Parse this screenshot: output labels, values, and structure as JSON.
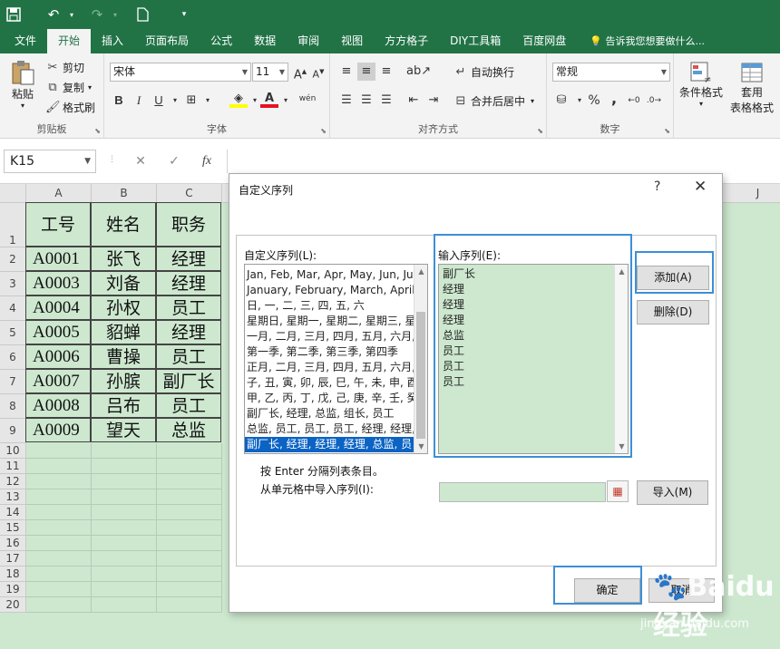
{
  "quick_access": {
    "save": "save-icon",
    "undo": "undo-icon",
    "redo": "redo-icon",
    "new": "new-file-icon",
    "customize": "customize-icon"
  },
  "tabs": [
    "文件",
    "开始",
    "插入",
    "页面布局",
    "公式",
    "数据",
    "审阅",
    "视图",
    "方方格子",
    "DIY工具箱",
    "百度网盘"
  ],
  "active_tab": "开始",
  "tell_me": "告诉我您想要做什么...",
  "ribbon": {
    "clipboard": {
      "paste": "粘贴",
      "cut": "剪切",
      "copy": "复制",
      "format_painter": "格式刷",
      "label": "剪贴板"
    },
    "font": {
      "name": "宋体",
      "size": "11",
      "bold": "B",
      "italic": "I",
      "underline": "U",
      "label": "字体",
      "phonetic": "wén"
    },
    "alignment": {
      "wrap": "自动换行",
      "merge": "合并后居中",
      "label": "对齐方式"
    },
    "number": {
      "format": "常规",
      "percent": "%",
      "comma": ",",
      "label": "数字"
    },
    "styles": {
      "conditional": "条件格式",
      "table_fmt_1": "套用",
      "table_fmt_2": "表格格式"
    }
  },
  "formula_bar": {
    "name_box": "K15",
    "cancel": "✕",
    "enter": "✓",
    "fx": "fx"
  },
  "sheet": {
    "columns": [
      "A",
      "B",
      "C",
      "J"
    ],
    "headers": [
      "工号",
      "姓名",
      "职务"
    ],
    "rows": [
      [
        "A0001",
        "张飞",
        "经理"
      ],
      [
        "A0003",
        "刘备",
        "经理"
      ],
      [
        "A0004",
        "孙权",
        "员工"
      ],
      [
        "A0005",
        "貂蝉",
        "经理"
      ],
      [
        "A0006",
        "曹操",
        "员工"
      ],
      [
        "A0007",
        "孙膑",
        "副厂长"
      ],
      [
        "A0008",
        "吕布",
        "员工"
      ],
      [
        "A0009",
        "望天",
        "总监"
      ]
    ],
    "row_numbers": [
      "1",
      "2",
      "3",
      "4",
      "5",
      "6",
      "7",
      "8",
      "9",
      "10",
      "11",
      "12",
      "13",
      "14",
      "15",
      "16",
      "17",
      "18",
      "19",
      "20"
    ]
  },
  "dialog": {
    "title": "自定义序列",
    "help": "?",
    "close": "✕",
    "tab": "自定义序列",
    "left_label": "自定义序列(L):",
    "right_label": "输入序列(E):",
    "custom_lists": [
      "Jan, Feb, Mar, Apr, May, Jun, Ju",
      "January, February, March, April,",
      "日, 一, 二, 三, 四, 五, 六",
      "星期日, 星期一, 星期二, 星期三, 星",
      "一月, 二月, 三月, 四月, 五月, 六月,",
      "第一季, 第二季, 第三季, 第四季",
      "正月, 二月, 三月, 四月, 五月, 六月,",
      "子, 丑, 寅, 卯, 辰, 巳, 午, 未, 申, 酉",
      "甲, 乙, 丙, 丁, 戊, 己, 庚, 辛, 壬, 癸",
      "副厂长, 经理, 总监, 组长, 员工",
      "总监, 员工, 员工, 员工, 经理, 经理,",
      "副厂长, 经理, 经理, 经理, 总监, 员"
    ],
    "selected_index": 11,
    "entries": [
      "副厂长",
      "经理",
      "经理",
      "经理",
      "总监",
      "员工",
      "员工",
      "员工"
    ],
    "add": "添加(A)",
    "delete": "删除(D)",
    "hint": "按 Enter 分隔列表条目。",
    "import_label": "从单元格中导入序列(I):",
    "import": "导入(M)",
    "ok": "确定",
    "cancel": "取消"
  },
  "watermark": {
    "brand": "Baidu经验",
    "url": "jingyan.baidu.com"
  }
}
